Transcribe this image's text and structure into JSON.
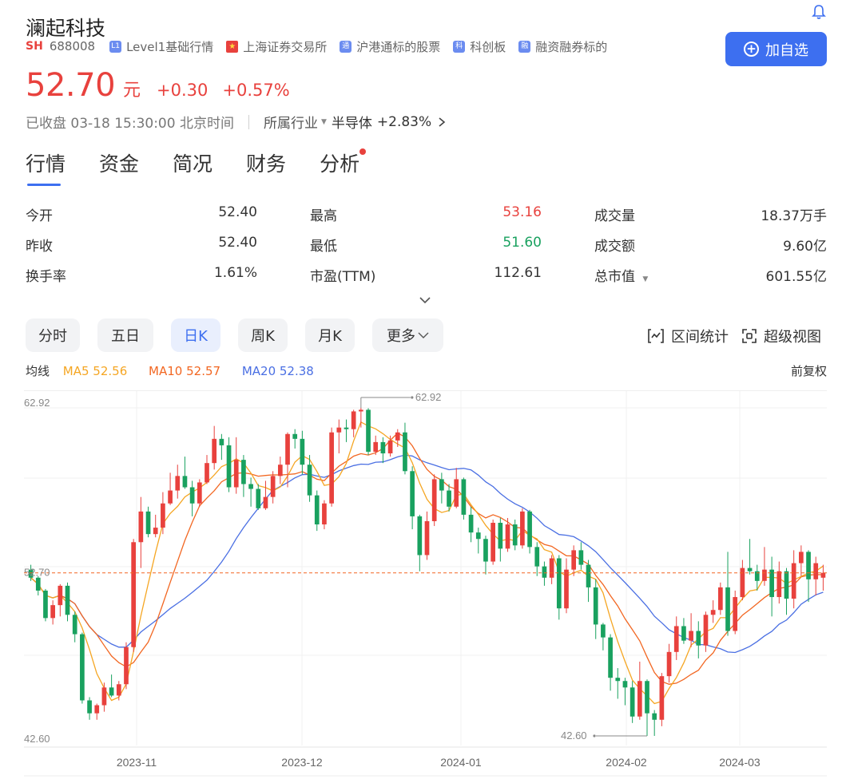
{
  "stock": {
    "name": "澜起科技",
    "market": "SH",
    "code": "688008",
    "tags": [
      {
        "icon": "L1",
        "label": "Level1基础行情"
      },
      {
        "icon": "flag",
        "label": "上海证券交易所"
      },
      {
        "icon": "通",
        "label": "沪港通标的股票"
      },
      {
        "icon": "科",
        "label": "科创板"
      },
      {
        "icon": "融",
        "label": "融资融券标的"
      }
    ],
    "add_button": "加自选"
  },
  "quote": {
    "price": "52.70",
    "unit": "元",
    "change": "+0.30",
    "change_pct": "+0.57%",
    "status": "已收盘 03-18 15:30:00 北京时间",
    "industry_label": "所属行业",
    "industry_name": "半导体",
    "industry_pct": "+2.83%"
  },
  "tabs": [
    "行情",
    "资金",
    "简况",
    "财务",
    "分析"
  ],
  "stats": [
    [
      {
        "label": "今开",
        "value": "52.40"
      },
      {
        "label": "最高",
        "value": "53.16",
        "color": "red"
      },
      {
        "label": "成交量",
        "value": "18.37万手"
      }
    ],
    [
      {
        "label": "昨收",
        "value": "52.40"
      },
      {
        "label": "最低",
        "value": "51.60",
        "color": "green"
      },
      {
        "label": "成交额",
        "value": "9.60亿"
      }
    ],
    [
      {
        "label": "换手率",
        "value": "1.61%"
      },
      {
        "label": "市盈(TTM)",
        "value": "112.61"
      },
      {
        "label": "总市值",
        "value": "601.55亿",
        "dropdown": true
      }
    ]
  ],
  "periods": [
    "分时",
    "五日",
    "日K",
    "周K",
    "月K",
    "更多"
  ],
  "active_period": "日K",
  "tools": {
    "range": "区间统计",
    "super": "超级视图"
  },
  "ma": {
    "label": "均线",
    "ma5": "MA5 52.56",
    "ma10": "MA10 52.57",
    "ma20": "MA20 52.38",
    "fuquan": "前复权"
  },
  "colors": {
    "up": "#e8413d",
    "down": "#19a15f",
    "accent": "#3d6ff0",
    "ma5": "#f5a623",
    "ma10": "#f26722",
    "ma20": "#4a6fe3"
  },
  "chart_data": {
    "type": "candlestick",
    "y_max_label": "62.92",
    "y_min_label": "42.60",
    "current_price_label": "52.70",
    "high_marker": "62.92",
    "low_marker": "42.60",
    "x_ticks": [
      "2023-11",
      "2023-12",
      "2024-01",
      "2024-02",
      "2024-03"
    ],
    "ylim": [
      42.6,
      62.92
    ],
    "candles": [
      [
        52.9,
        52.4,
        53.2,
        52.2
      ],
      [
        52.4,
        51.6,
        52.5,
        51.3
      ],
      [
        51.6,
        49.9,
        51.7,
        49.7
      ],
      [
        49.9,
        50.7,
        51.0,
        49.5
      ],
      [
        50.7,
        51.9,
        52.0,
        50.0
      ],
      [
        51.9,
        50.1,
        52.1,
        49.7
      ],
      [
        50.1,
        48.9,
        50.3,
        48.4
      ],
      [
        48.9,
        44.8,
        49.0,
        44.6
      ],
      [
        44.8,
        44.0,
        45.0,
        43.6
      ],
      [
        44.0,
        44.5,
        44.6,
        43.6
      ],
      [
        44.5,
        45.6,
        45.9,
        44.1
      ],
      [
        45.6,
        45.1,
        46.4,
        45.0
      ],
      [
        45.1,
        45.8,
        46.0,
        44.8
      ],
      [
        45.8,
        48.1,
        48.4,
        45.5
      ],
      [
        48.1,
        54.6,
        54.8,
        47.8
      ],
      [
        54.6,
        56.5,
        57.4,
        53.0
      ],
      [
        56.5,
        55.1,
        56.8,
        54.9
      ],
      [
        55.1,
        55.5,
        56.3,
        54.9
      ],
      [
        55.5,
        57.0,
        57.7,
        55.1
      ],
      [
        57.0,
        57.8,
        58.9,
        56.9
      ],
      [
        57.8,
        58.7,
        59.4,
        57.3
      ],
      [
        58.7,
        58.0,
        59.9,
        57.9
      ],
      [
        58.0,
        57.0,
        58.4,
        56.2
      ],
      [
        57.0,
        58.3,
        58.5,
        56.8
      ],
      [
        58.3,
        59.5,
        60.0,
        58.2
      ],
      [
        59.5,
        61.0,
        61.8,
        59.1
      ],
      [
        61.0,
        60.6,
        61.3,
        59.7
      ],
      [
        60.6,
        58.0,
        61.1,
        57.7
      ],
      [
        58.0,
        59.7,
        61.1,
        57.6
      ],
      [
        59.7,
        58.2,
        60.0,
        57.4
      ],
      [
        58.2,
        57.9,
        58.6,
        56.8
      ],
      [
        57.9,
        56.7,
        58.2,
        56.6
      ],
      [
        56.7,
        57.4,
        58.4,
        56.6
      ],
      [
        57.4,
        58.7,
        59.0,
        57.0
      ],
      [
        58.7,
        59.4,
        59.9,
        58.2
      ],
      [
        59.4,
        61.3,
        61.4,
        58.0
      ],
      [
        61.3,
        61.0,
        61.6,
        60.4
      ],
      [
        61.0,
        59.4,
        61.5,
        58.8
      ],
      [
        59.4,
        57.5,
        60.0,
        57.1
      ],
      [
        57.5,
        55.7,
        57.8,
        55.3
      ],
      [
        55.7,
        57.0,
        57.2,
        55.4
      ],
      [
        57.0,
        61.4,
        61.7,
        56.8
      ],
      [
        61.4,
        61.7,
        62.2,
        60.1
      ],
      [
        61.7,
        61.6,
        62.2,
        60.8
      ],
      [
        61.6,
        62.7,
        62.8,
        61.1
      ],
      [
        62.7,
        62.8,
        62.92,
        61.7
      ],
      [
        62.8,
        60.2,
        62.9,
        60.0
      ],
      [
        60.2,
        60.8,
        61.2,
        60.0
      ],
      [
        60.8,
        60.1,
        61.1,
        59.5
      ],
      [
        60.1,
        60.9,
        61.2,
        59.9
      ],
      [
        60.9,
        61.4,
        61.6,
        60.5
      ],
      [
        61.4,
        59.0,
        62.0,
        58.8
      ],
      [
        59.0,
        56.2,
        59.3,
        55.4
      ],
      [
        56.2,
        53.8,
        56.3,
        52.8
      ],
      [
        53.8,
        55.9,
        56.5,
        53.5
      ],
      [
        55.9,
        58.5,
        58.8,
        55.6
      ],
      [
        58.5,
        57.8,
        58.9,
        57.0
      ],
      [
        57.8,
        56.8,
        58.2,
        56.5
      ],
      [
        56.8,
        58.5,
        59.2,
        56.7
      ],
      [
        58.5,
        56.3,
        58.6,
        56.0
      ],
      [
        56.3,
        55.2,
        56.8,
        54.6
      ],
      [
        55.2,
        54.8,
        55.5,
        53.9
      ],
      [
        54.8,
        53.4,
        55.0,
        52.6
      ],
      [
        53.4,
        55.8,
        56.0,
        53.2
      ],
      [
        55.8,
        54.2,
        56.1,
        53.4
      ],
      [
        54.2,
        55.7,
        56.1,
        54.0
      ],
      [
        55.7,
        54.4,
        56.0,
        54.1
      ],
      [
        54.4,
        56.5,
        56.7,
        54.2
      ],
      [
        56.5,
        54.3,
        56.6,
        53.9
      ],
      [
        54.3,
        53.1,
        54.6,
        52.5
      ],
      [
        53.1,
        52.4,
        53.4,
        51.9
      ],
      [
        52.4,
        53.6,
        53.8,
        52.0
      ],
      [
        53.6,
        50.5,
        53.8,
        49.8
      ],
      [
        50.5,
        52.9,
        53.6,
        50.2
      ],
      [
        52.9,
        54.1,
        54.4,
        52.5
      ],
      [
        54.1,
        53.2,
        54.6,
        52.9
      ],
      [
        53.2,
        51.8,
        53.5,
        50.9
      ],
      [
        51.8,
        49.5,
        52.3,
        48.6
      ],
      [
        49.5,
        48.7,
        49.6,
        47.9
      ],
      [
        48.7,
        46.2,
        48.9,
        45.4
      ],
      [
        46.2,
        46.0,
        46.8,
        44.9
      ],
      [
        46.0,
        45.6,
        46.2,
        44.5
      ],
      [
        45.6,
        43.8,
        46.0,
        43.4
      ],
      [
        43.8,
        46.0,
        47.2,
        43.6
      ],
      [
        46.0,
        44.0,
        46.1,
        42.6
      ],
      [
        44.0,
        43.6,
        44.2,
        42.6
      ],
      [
        43.6,
        46.3,
        46.5,
        43.2
      ],
      [
        46.3,
        47.8,
        48.3,
        45.9
      ],
      [
        47.8,
        49.4,
        50.0,
        47.3
      ],
      [
        49.4,
        48.5,
        49.9,
        48.3
      ],
      [
        48.5,
        49.1,
        50.2,
        48.1
      ],
      [
        49.1,
        48.2,
        49.7,
        47.4
      ],
      [
        48.2,
        50.1,
        50.3,
        47.8
      ],
      [
        50.1,
        50.4,
        51.0,
        49.6
      ],
      [
        50.4,
        51.8,
        52.1,
        50.1
      ],
      [
        51.8,
        49.1,
        54.0,
        48.8
      ],
      [
        49.1,
        51.2,
        51.6,
        48.9
      ],
      [
        51.2,
        53.0,
        53.5,
        51.0
      ],
      [
        53.0,
        52.8,
        54.8,
        52.6
      ],
      [
        52.8,
        52.2,
        53.2,
        51.6
      ],
      [
        52.2,
        52.9,
        54.3,
        51.9
      ],
      [
        52.9,
        51.2,
        53.7,
        50.0
      ],
      [
        51.2,
        52.8,
        53.4,
        50.8
      ],
      [
        52.8,
        51.1,
        53.0,
        50.1
      ],
      [
        51.1,
        53.3,
        54.1,
        50.5
      ],
      [
        53.3,
        54.0,
        54.4,
        52.5
      ],
      [
        54.0,
        52.3,
        54.1,
        50.9
      ],
      [
        52.3,
        53.3,
        53.7,
        51.3
      ],
      [
        52.4,
        52.7,
        53.2,
        51.6
      ]
    ]
  }
}
